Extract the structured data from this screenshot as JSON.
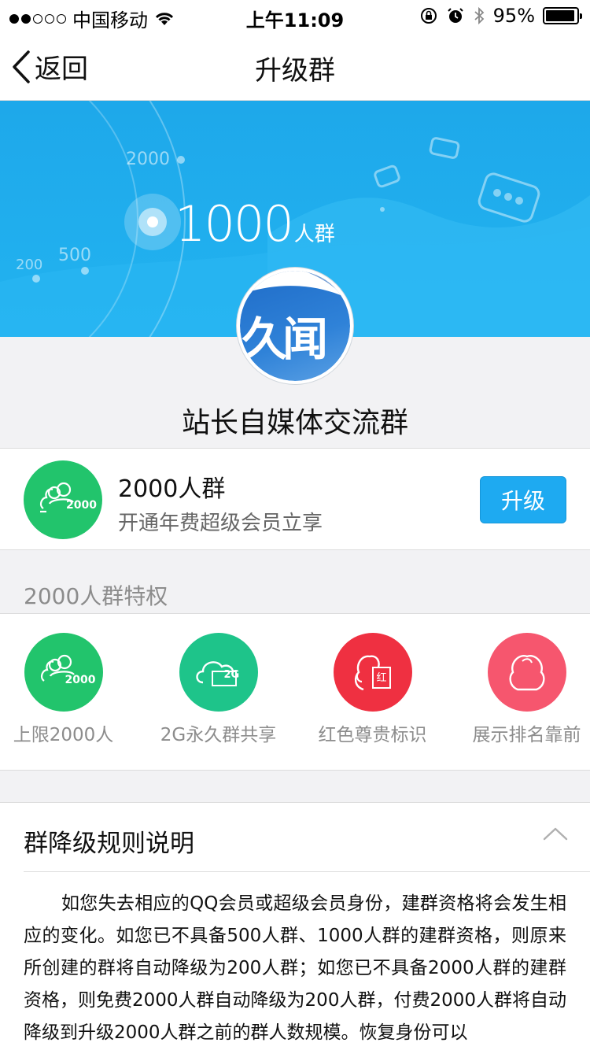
{
  "status_bar": {
    "carrier": "中国移动",
    "time": "上午11:09",
    "battery": "95%",
    "battery_level": 0.95,
    "signal_strength": 2
  },
  "nav": {
    "back_label": "返回",
    "title": "升级群"
  },
  "banner": {
    "labels": [
      "200",
      "500",
      "2000"
    ],
    "current_size": "1000",
    "current_unit": "人群"
  },
  "group": {
    "avatar_text": "久闻",
    "name": "站长自媒体交流群"
  },
  "upgrade": {
    "tier_badge": "2000",
    "title": "2000人群",
    "subtitle": "开通年费超级会员立享",
    "button_label": "升级"
  },
  "privileges": {
    "header": "2000人群特权",
    "items": [
      {
        "label": "上限2000人",
        "icon": "people-2000-icon",
        "badge": "2000",
        "color": "#22c46c"
      },
      {
        "label": "2G永久群共享",
        "icon": "cloud-2g-icon",
        "badge": "2G",
        "color": "#1ec48a"
      },
      {
        "label": "红色尊贵标识",
        "icon": "penguin-red-icon",
        "badge": "红",
        "color": "#ef3041"
      },
      {
        "label": "展示排名靠前",
        "icon": "penguin-icon",
        "badge": "",
        "color": "#f6566e"
      }
    ]
  },
  "rules": {
    "title": "群降级规则说明",
    "body": "如您失去相应的QQ会员或超级会员身份，建群资格将会发生相应的变化。如您已不具备500人群、1000人群的建群资格，则原来所创建的群将自动降级为200人群；如您已不具备2000人群的建群资格，则免费2000人群自动降级为200人群，付费2000人群将自动降级到升级2000人群之前的群人数规模。恢复身份可以"
  },
  "colors": {
    "accent": "#1eaaf1",
    "banner": "#1ea8ea",
    "green": "#22c46c"
  }
}
